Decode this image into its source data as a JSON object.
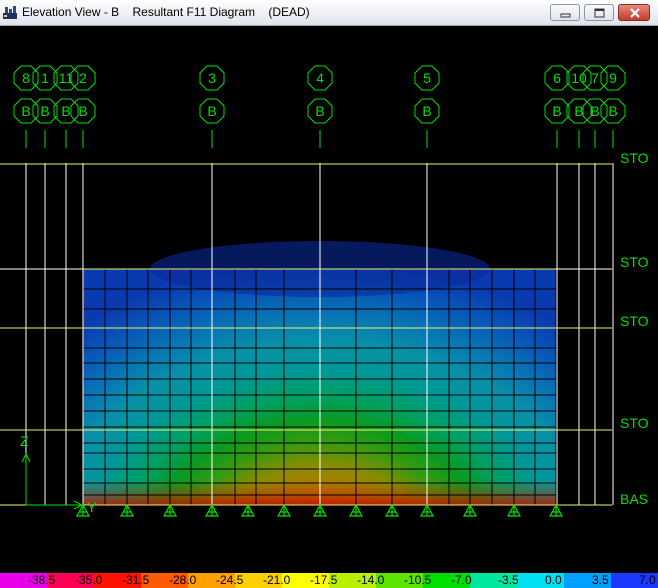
{
  "window": {
    "title": "Elevation View - B    Resultant F11 Diagram    (DEAD)"
  },
  "title_buttons": {
    "minimize_icon": "minimize-icon",
    "maximize_icon": "maximize-icon",
    "close_icon": "close-icon"
  },
  "colors": {
    "grid_line": "#ffffff",
    "bubble": "#00e000",
    "story_line": "#f0f06a",
    "story_label": "#00e000",
    "support": "#00e000",
    "axis": "#00e000"
  },
  "grid_bubbles": [
    {
      "top": "8",
      "bottom": "B"
    },
    {
      "top": "1",
      "bottom": "B"
    },
    {
      "top": "11",
      "bottom": "B"
    },
    {
      "top": "2",
      "bottom": "B"
    },
    {
      "top": "3",
      "bottom": "B"
    },
    {
      "top": "4",
      "bottom": "B"
    },
    {
      "top": "5",
      "bottom": "B"
    },
    {
      "top": "6",
      "bottom": "B"
    },
    {
      "top": "10",
      "bottom": "B"
    },
    {
      "top": "7",
      "bottom": "B"
    },
    {
      "top": "9",
      "bottom": "B"
    }
  ],
  "story_labels": [
    "STO",
    "STO",
    "STO",
    "STO",
    "BAS"
  ],
  "axis": {
    "z_label": "Z",
    "y_label": "Y"
  },
  "scale": {
    "values": [
      "-38.5",
      "-35.0",
      "-31.5",
      "-28.0",
      "-24.5",
      "-21.0",
      "-17.5",
      "-14.0",
      "-10.5",
      "-7.0",
      "-3.5",
      "0.0",
      "3.5",
      "7.0"
    ],
    "colors": [
      "#e800e8",
      "#ff0055",
      "#ff1200",
      "#ff5a00",
      "#ffa000",
      "#ffd000",
      "#ffff00",
      "#b8f000",
      "#5ee400",
      "#00e000",
      "#00e8a0",
      "#00e0f0",
      "#00a0ff",
      "#1a38ff"
    ]
  }
}
